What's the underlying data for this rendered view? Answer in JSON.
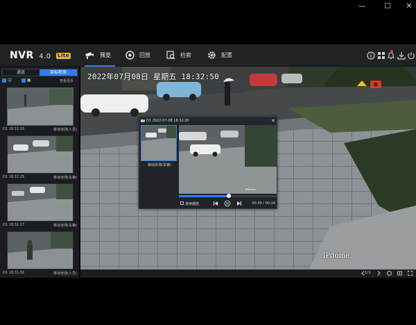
{
  "window": {
    "minimize": "—",
    "maximize": "☐",
    "close": "✕"
  },
  "app": {
    "logo": "NVR",
    "version": "4.0",
    "edition": "Lite"
  },
  "nav": {
    "tabs": [
      {
        "label": "预览",
        "icon": "camera-icon",
        "active": true
      },
      {
        "label": "回放",
        "icon": "playback-icon",
        "active": false
      },
      {
        "label": "检索",
        "icon": "search-icon",
        "active": false
      },
      {
        "label": "配置",
        "icon": "gear-icon",
        "active": false
      }
    ]
  },
  "header_icons": [
    "info-icon",
    "apps-icon",
    "notification-icon",
    "download-icon",
    "power-icon"
  ],
  "left_panel": {
    "tabs": [
      {
        "label": "通道",
        "active": false
      },
      {
        "label": "目标检测",
        "active": true
      }
    ],
    "more": "查看更多",
    "events": [
      {
        "time": "D1 18:32:33",
        "type": "移动侦测(人员)"
      },
      {
        "time": "D1 18:32:25",
        "type": "移动侦测(车辆)"
      },
      {
        "time": "D1 18:32:17",
        "type": "移动侦测(车辆)"
      },
      {
        "time": "D1 18:31:56",
        "type": "移动侦测(人员)"
      }
    ]
  },
  "live_view": {
    "osd_time": "2022年07月08日  星期五  18:32:50",
    "brand": "IPdome"
  },
  "popup": {
    "title": "D1 2022-07-08 18:32:20",
    "close": "✕",
    "thumb_label": "移动侦测(车辆)",
    "video_brand": "IPdome",
    "continuous_label": "连续播放",
    "duration": "00:39 / 00:16",
    "progress": 0.51
  },
  "bottom_bar": {
    "page": "1/1"
  },
  "colors": {
    "accent": "#2f7cf6",
    "header_bg": "#202226",
    "panel_bg": "#1a1c20"
  }
}
